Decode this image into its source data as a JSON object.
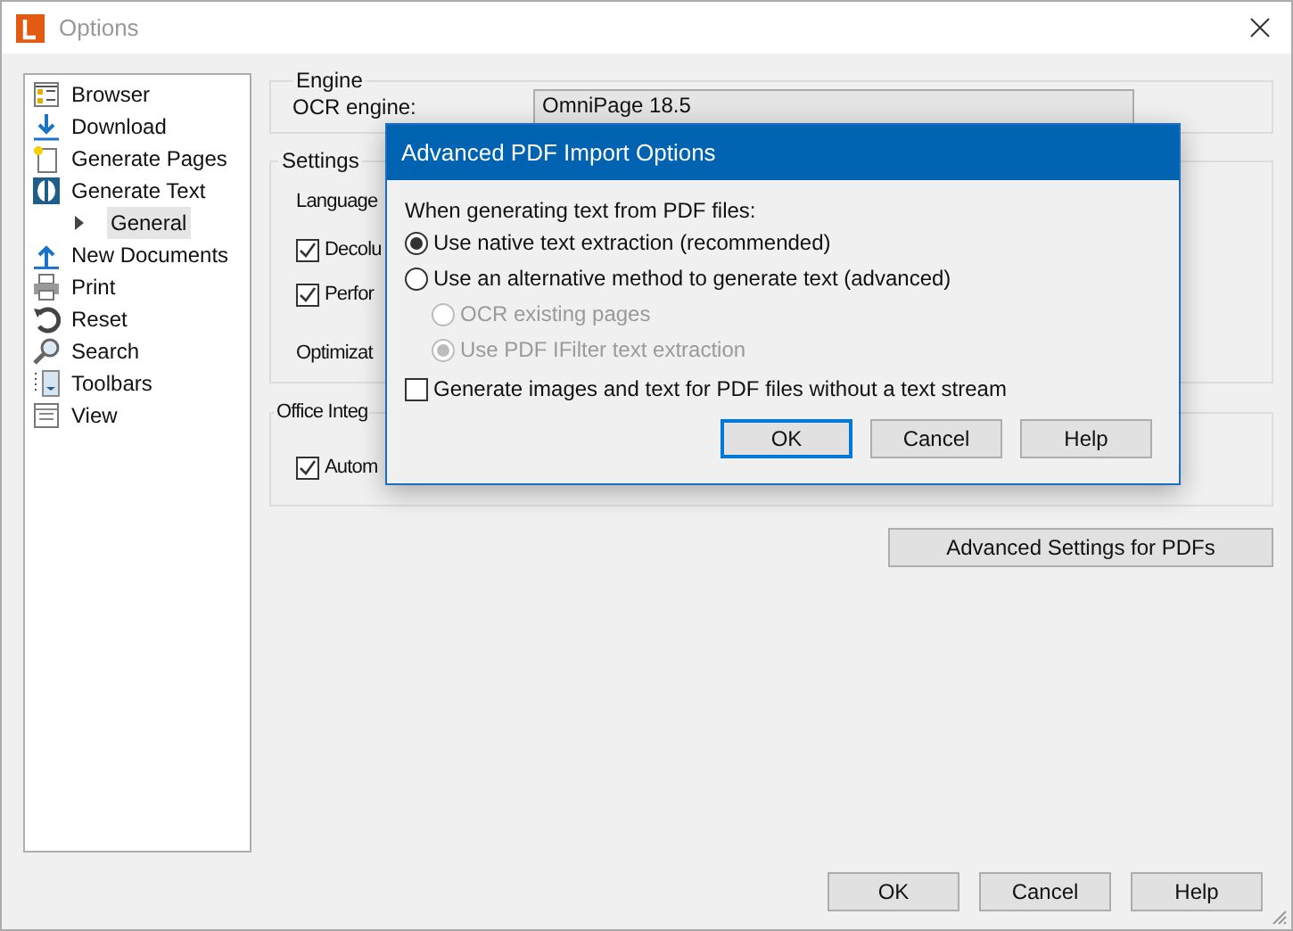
{
  "window": {
    "title": "Options"
  },
  "sidebar": {
    "items": [
      {
        "label": "Browser",
        "selected": false
      },
      {
        "label": "Download",
        "selected": false
      },
      {
        "label": "Generate Pages",
        "selected": false
      },
      {
        "label": "Generate Text",
        "selected": false,
        "children": [
          {
            "label": "General",
            "selected": true,
            "expanded": false
          }
        ]
      },
      {
        "label": "New Documents",
        "selected": false
      },
      {
        "label": "Print",
        "selected": false
      },
      {
        "label": "Reset",
        "selected": false
      },
      {
        "label": "Search",
        "selected": false
      },
      {
        "label": "Toolbars",
        "selected": false
      },
      {
        "label": "View",
        "selected": false
      }
    ]
  },
  "engine": {
    "title": "Engine",
    "ocr_label": "OCR engine:",
    "ocr_value": "OmniPage 18.5"
  },
  "settings": {
    "title": "Settings",
    "language_label": "Language",
    "checkboxes": [
      {
        "label": "Decolu",
        "checked": true
      },
      {
        "label": "Perfor",
        "checked": true
      }
    ],
    "optimize_label": "Optimizat"
  },
  "office": {
    "title": "Office Integ",
    "checkboxes": [
      {
        "label": "Autom",
        "checked": true
      }
    ]
  },
  "advanced_button": "Advanced Settings for PDFs",
  "buttons": [
    {
      "label": "OK"
    },
    {
      "label": "Cancel"
    },
    {
      "label": "Help"
    }
  ],
  "dialog": {
    "title": "Advanced PDF Import Options",
    "prompt": "When generating text from PDF files:",
    "options": [
      {
        "label": "Use native text extraction (recommended)",
        "selected": true,
        "disabled": false
      },
      {
        "label": "Use an alternative method to generate text (advanced)",
        "selected": false,
        "disabled": false,
        "children": [
          {
            "label": "OCR existing pages",
            "selected": false,
            "disabled": true
          },
          {
            "label": "Use PDF IFilter text extraction",
            "selected": true,
            "disabled": true
          }
        ]
      }
    ],
    "checkbox": {
      "label": "Generate images and text for PDF files without a text stream",
      "checked": false
    },
    "buttons": [
      {
        "label": "OK",
        "focused": true
      },
      {
        "label": "Cancel",
        "focused": false
      },
      {
        "label": "Help",
        "focused": false
      }
    ]
  }
}
